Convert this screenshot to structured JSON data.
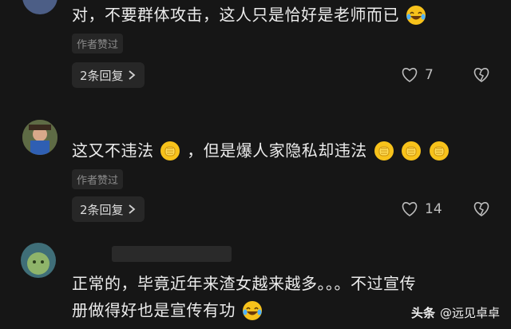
{
  "comments": [
    {
      "text": "对，不要群体攻击，这人只是恰好是老师而已",
      "author_liked": "作者赞过",
      "replies_label": "2条回复",
      "like_count": "7"
    },
    {
      "text_a": "这又不违法",
      "text_b": "，但是爆人家隐私却违法",
      "author_liked": "作者赞过",
      "replies_label": "2条回复",
      "like_count": "14"
    },
    {
      "line1": "正常的，毕竟近年来渣女越来越多。。。不过宣传",
      "line2": "册做得好也是宣传有功"
    }
  ],
  "watermark": {
    "brand": "头条",
    "handle": "@远见卓卓"
  },
  "colors": {
    "background": "#161616",
    "text": "#ececec",
    "muted": "#8c8c8c",
    "chip": "#272727",
    "emoji": "#f7c21b"
  },
  "icons": [
    "laugh-cry-emoji-icon",
    "clap-emoji-icon",
    "heart-outline-icon",
    "broken-heart-icon",
    "chevron-right-icon"
  ]
}
